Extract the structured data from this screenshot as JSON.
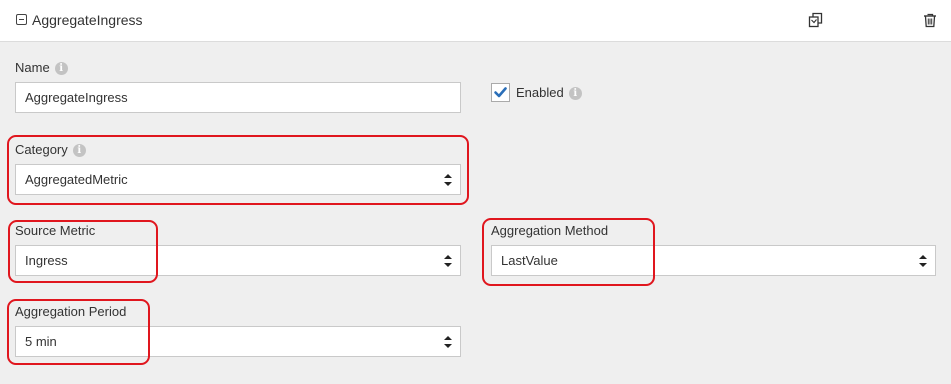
{
  "header": {
    "title": "AggregateIngress"
  },
  "form": {
    "name": {
      "label": "Name",
      "value": "AggregateIngress"
    },
    "enabled": {
      "label": "Enabled",
      "checked": true
    },
    "category": {
      "label": "Category",
      "value": "AggregatedMetric"
    },
    "source_metric": {
      "label": "Source Metric",
      "value": "Ingress"
    },
    "aggregation_method": {
      "label": "Aggregation Method",
      "value": "LastValue"
    },
    "aggregation_period": {
      "label": "Aggregation Period",
      "value": "5 min"
    }
  },
  "info_icon_glyph": "i",
  "colors": {
    "highlight": "#e0161e",
    "checkbox_check": "#2a6eb8"
  }
}
